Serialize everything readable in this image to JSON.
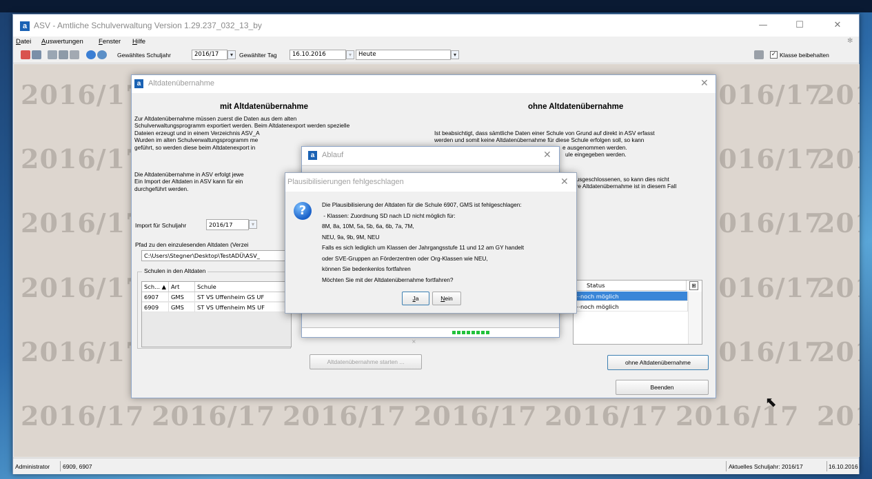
{
  "window": {
    "title": "ASV - Amtliche Schulverwaltung Version 1.29.237_032_13_by",
    "minimize": "—",
    "maximize": "☐",
    "close": "✕"
  },
  "menu": [
    "Datei",
    "Auswertungen",
    "Fenster",
    "Hilfe"
  ],
  "toolbar": {
    "schuljahr_label": "Gewähltes Schuljahr",
    "schuljahr_value": "2016/17",
    "tag_label": "Gewählter Tag",
    "tag_value": "16.10.2016",
    "heute_value": "Heute",
    "klasse_beibehalten": "Klasse beibehalten"
  },
  "watermark": "2016/17",
  "watermark_partial": "201",
  "dialog_main": {
    "title": "Altdatenübernahme",
    "left": {
      "heading": "mit Altdatenübernahme",
      "para1": [
        "Zur Altdatenübernahme müssen zuerst die Daten aus dem alten",
        "Schulverwaltungsprogramm exportiert werden. Beim Altdatenexport werden spezielle",
        "Dateien erzeugt und in einem Verzeichnis ASV_A",
        "Wurden im alten Schulverwaltungsprogramm me",
        "geführt, so werden diese beim Altdatenexport in"
      ],
      "para2": [
        "Die Altdatenübernahme in ASV erfolgt jewe",
        "Ein Import der Altdaten in ASV kann für ein",
        "durchgeführt werden."
      ],
      "import_label": "Import für Schuljahr",
      "import_value": "2016/17",
      "path_label": "Pfad zu den einzulesenden Altdaten (Verzei",
      "path_value": "C:\\Users\\Stegner\\Desktop\\TestADÜ\\ASV_",
      "schulen_group": "Schulen in den Altdaten",
      "columns": [
        "Sch... ▲",
        "Art",
        "Schule"
      ],
      "rows": [
        [
          "6907",
          "GMS",
          "ST VS Uffenheim GS UF"
        ],
        [
          "6909",
          "GMS",
          "ST VS Uffenheim MS UF"
        ]
      ],
      "start_button": "Altdatenübernahme starten ..."
    },
    "right": {
      "heading": "ohne Altdatenübernahme",
      "para1": [
        "Ist beabsichtigt, dass sämtliche Daten einer Schule von Grund auf direkt in ASV erfasst",
        "werden und somit keine Altdatenübernahme für diese Schule erfolgen soll, so kann",
        "e ausgenommen werden.",
        "ule eingegeben werden."
      ],
      "para2": [
        "ausgeschlossenen, so kann dies nicht",
        "ere Altdatenübernahme ist in diesem Fall"
      ],
      "status_header": "Status",
      "status_rows": [
        "noch möglich",
        "noch möglich"
      ],
      "ohne_button": "ohne Altdatenübernahme",
      "beenden_button": "Beenden"
    }
  },
  "dialog_ablauf": {
    "title": "Ablauf"
  },
  "dialog_plaus": {
    "title": "Plausibilisierungen fehlgeschlagen",
    "lines": [
      "Die Plausibilisierung der Altdaten für die Schule 6907, GMS ist fehlgeschlagen:",
      " - Klassen: Zuordnung SD nach LD nicht möglich für:",
      "8M, 8a, 10M, 5a, 5b, 6a, 6b, 7a, 7M,",
      "NEU, 9a, 9b, 9M, NEU",
      "Falls es sich lediglich um Klassen der Jahrgangsstufe 11 und 12 am GY handelt",
      "oder SVE-Gruppen an Förderzentren oder Org-Klassen wie NEU,",
      "können Sie bedenkenlos fortfahren",
      "Möchten Sie mit der Altdatenübernahme fortfahren?"
    ],
    "yes_button": "Ja",
    "no_button": "Nein"
  },
  "statusbar": {
    "user": "Administrator",
    "schools": "6909, 6907",
    "current_year": "Aktuelles Schuljahr: 2016/17",
    "date": "16.10.2016"
  }
}
